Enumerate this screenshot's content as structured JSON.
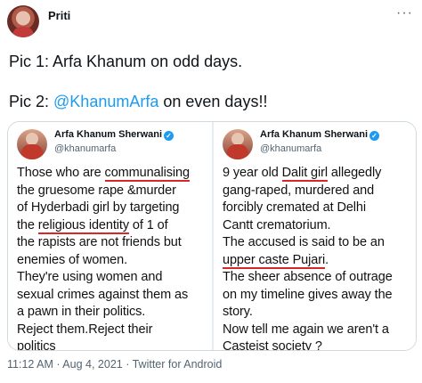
{
  "tweet": {
    "author_name": "Priti",
    "line1": "Pic 1: Arfa Khanum on odd days.",
    "line2_prefix": "Pic 2: ",
    "line2_mention": "@KhanumArfa",
    "line2_suffix": " on even days!!",
    "timestamp": "11:12 AM · Aug 4, 2021 · Twitter for Android"
  },
  "pic1": {
    "name": "Arfa Khanum Sherwani",
    "handle": "@khanumarfa",
    "lines": [
      {
        "pre": "Those who are ",
        "ul": "communalising",
        "post": ""
      },
      {
        "pre": "the gruesome rape &murder",
        "ul": "",
        "post": ""
      },
      {
        "pre": "of Hyderbadi girl by targeting",
        "ul": "",
        "post": ""
      },
      {
        "pre": "the ",
        "ul": "religious identity",
        "post": " of 1 of"
      },
      {
        "pre": "the rapists are not friends but",
        "ul": "",
        "post": ""
      },
      {
        "pre": "enemies of women.",
        "ul": "",
        "post": ""
      },
      {
        "pre": "They're using women and",
        "ul": "",
        "post": ""
      },
      {
        "pre": "sexual crimes against them as",
        "ul": "",
        "post": ""
      },
      {
        "pre": "a pawn in their politics.",
        "ul": "",
        "post": ""
      },
      {
        "pre": "Reject them.Reject their",
        "ul": "",
        "post": ""
      },
      {
        "pre": "politics",
        "ul": "",
        "post": ""
      }
    ]
  },
  "pic2": {
    "name": "Arfa Khanum Sherwani",
    "handle": "@khanumarfa",
    "lines": [
      {
        "pre": "9 year old ",
        "ul": "Dalit girl",
        "post": " allegedly"
      },
      {
        "pre": "gang-raped, murdered and",
        "ul": "",
        "post": ""
      },
      {
        "pre": "forcibly cremated at Delhi",
        "ul": "",
        "post": ""
      },
      {
        "pre": "Cantt crematorium.",
        "ul": "",
        "post": ""
      },
      {
        "pre": "The accused is said to be an",
        "ul": "",
        "post": ""
      },
      {
        "pre": "",
        "ul": "upper caste Pujari",
        "post": "."
      },
      {
        "pre": "The sheer absence of outrage",
        "ul": "",
        "post": ""
      },
      {
        "pre": "on my timeline gives away the",
        "ul": "",
        "post": ""
      },
      {
        "pre": "story.",
        "ul": "",
        "post": ""
      },
      {
        "pre": "Now tell me again we aren't a",
        "ul": "",
        "post": ""
      },
      {
        "pre": "Casteist society ?",
        "ul": "",
        "post": ""
      }
    ]
  },
  "icons": {
    "more": "more-icon",
    "verified": "verified-badge-icon"
  },
  "colors": {
    "mention": "#1d9bf0",
    "underline": "#d9262b",
    "verified": "#1d9bf0",
    "secondary_text": "#536471"
  }
}
